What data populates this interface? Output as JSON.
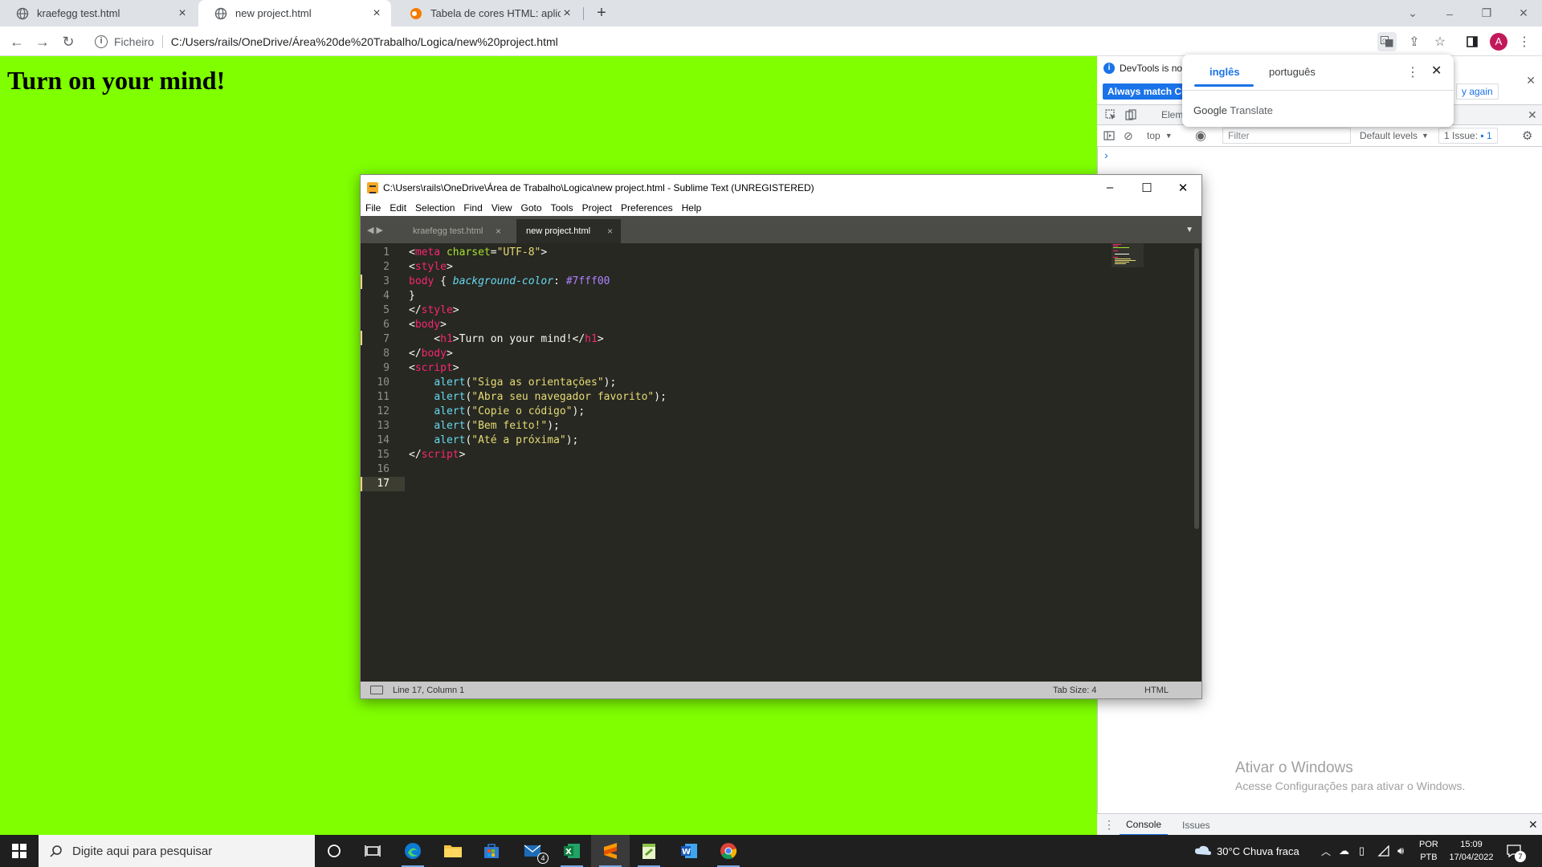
{
  "browser": {
    "tabs": [
      {
        "title": "kraefegg test.html"
      },
      {
        "title": "new project.html"
      },
      {
        "title": "Tabela de cores HTML: aplicando"
      }
    ],
    "omnibox": {
      "scheme": "Ficheiro",
      "url": "C:/Users/rails/OneDrive/Área%20de%20Trabalho/Logica/new%20project.html"
    },
    "avatar_letter": "A"
  },
  "page": {
    "heading": "Turn on your mind!",
    "background": "#7fff00"
  },
  "devtools": {
    "info_text": "DevTools is no",
    "match_button": "Always match Ch",
    "again_button": "y again",
    "tabs_partial": "Elem",
    "tabs_count": "1",
    "context": "top",
    "filter_placeholder": "Filter",
    "levels": "Default levels",
    "issues_label": "1 Issue:",
    "issues_count": "1",
    "prompt": "›",
    "bottom_tabs": [
      "Console",
      "Issues"
    ]
  },
  "translate": {
    "lang_from": "inglês",
    "lang_to": "português",
    "google": "Google",
    "translate": "Translate"
  },
  "sublime": {
    "title": "C:\\Users\\rails\\OneDrive\\Área de Trabalho\\Logica\\new project.html - Sublime Text (UNREGISTERED)",
    "menu": [
      "File",
      "Edit",
      "Selection",
      "Find",
      "View",
      "Goto",
      "Tools",
      "Project",
      "Preferences",
      "Help"
    ],
    "tabs": [
      "kraefegg test.html",
      "new project.html"
    ],
    "line_numbers": [
      "1",
      "2",
      "3",
      "4",
      "5",
      "6",
      "7",
      "8",
      "9",
      "10",
      "11",
      "12",
      "13",
      "14",
      "15",
      "16",
      "17"
    ],
    "status": {
      "position": "Line 17, Column 1",
      "tab_size": "Tab Size: 4",
      "syntax": "HTML"
    }
  },
  "watermark": {
    "title": "Ativar o Windows",
    "subtitle": "Acesse Configurações para ativar o Windows."
  },
  "taskbar": {
    "search_placeholder": "Digite aqui para pesquisar",
    "mail_badge": "4",
    "weather": "30°C  Chuva fraca",
    "lang_top": "POR",
    "lang_bottom": "PTB",
    "time": "15:09",
    "date": "17/04/2022",
    "notif_count": "7"
  }
}
